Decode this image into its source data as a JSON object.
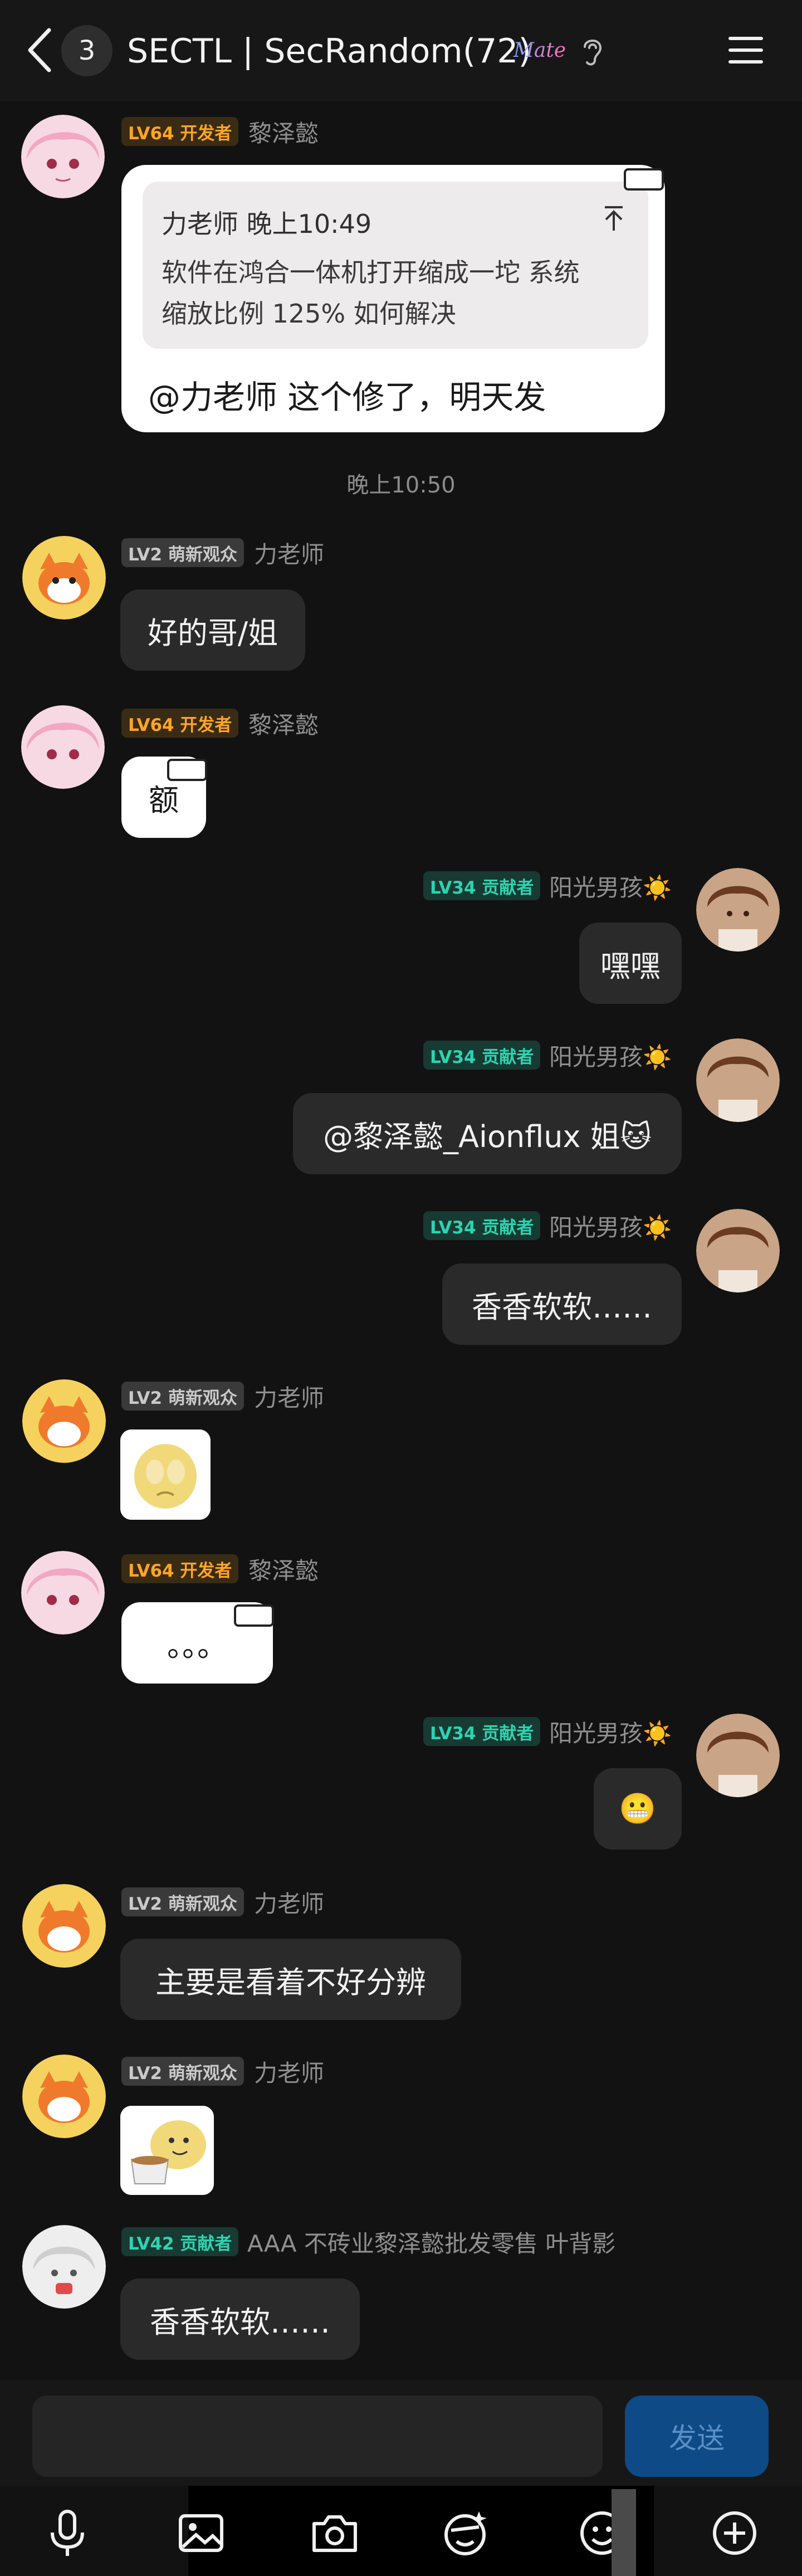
{
  "header": {
    "back_count": "3",
    "title": "SECTL | SecRandom(72)",
    "title_badge_text": "Mate"
  },
  "messages": [
    {
      "sender": "黎泽懿",
      "badge": "LV64 开发者",
      "quote": {
        "author_time": "力老师 晚上10:49",
        "text_line1": "软件在鸿合一体机打开缩成一坨 系统",
        "text_line2": "缩放比例 125% 如何解决"
      },
      "reply": "@力老师 这个修了，明天发"
    },
    {
      "time_separator": "晚上10:50"
    },
    {
      "sender": "力老师",
      "badge": "LV2 萌新观众",
      "text": "好的哥/姐"
    },
    {
      "sender": "黎泽懿",
      "badge": "LV64 开发者",
      "text": "额"
    },
    {
      "sender": "阳光男孩☀️",
      "badge": "LV34 贡献者",
      "text": "嘿嘿"
    },
    {
      "sender": "阳光男孩☀️",
      "badge": "LV34 贡献者",
      "text": "@黎泽懿_Aionflux 姐🐱"
    },
    {
      "sender": "阳光男孩☀️",
      "badge": "LV34 贡献者",
      "text": "香香软软……"
    },
    {
      "sender": "力老师",
      "badge": "LV2 萌新观众",
      "image": "crying-blob-sticker"
    },
    {
      "sender": "黎泽懿",
      "badge": "LV64 开发者",
      "text": "。。。"
    },
    {
      "sender": "阳光男孩☀️",
      "badge": "LV34 贡献者",
      "text": "😬"
    },
    {
      "sender": "力老师",
      "badge": "LV2 萌新观众",
      "text": "主要是看着不好分辨"
    },
    {
      "sender": "力老师",
      "badge": "LV2 萌新观众",
      "image": "tea-blob-sticker"
    },
    {
      "sender": "AAA 不砖业黎泽懿批发零售 叶背影",
      "badge": "LV42 贡献者",
      "text": "香香软软……"
    }
  ],
  "input": {
    "placeholder": "",
    "send_label": "发送"
  },
  "toolbar": {
    "icons": [
      "microphone-icon",
      "image-icon",
      "camera-icon",
      "sticker-face-icon",
      "emoji-icon",
      "plus-icon"
    ]
  },
  "colors": {
    "dev_badge": "#ffa526",
    "contributor_badge": "#2ed3b0",
    "send_button": "#0d4a86"
  }
}
